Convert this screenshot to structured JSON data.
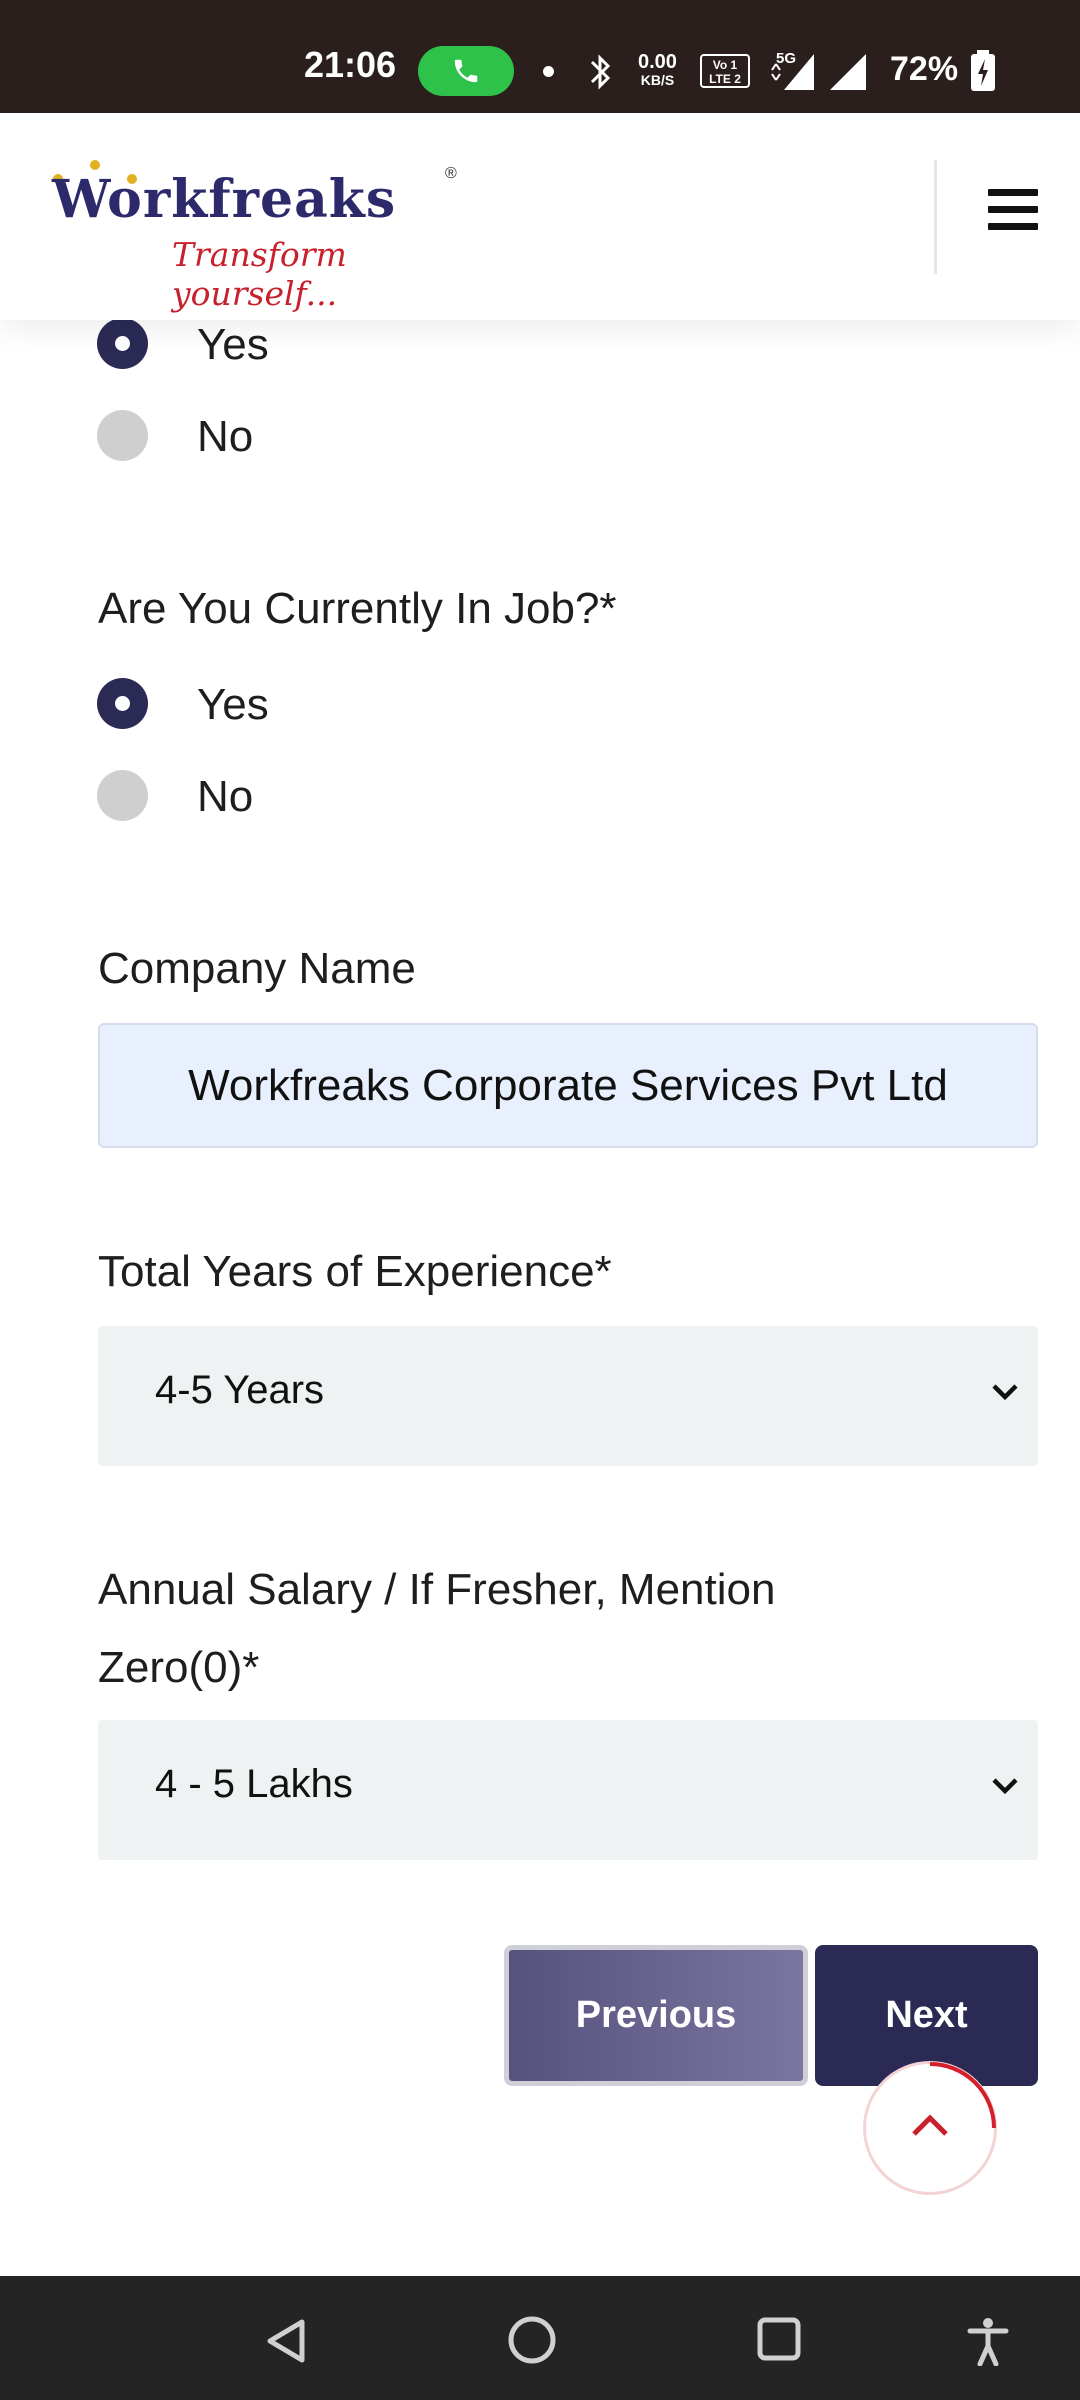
{
  "status_bar": {
    "time": "21:06",
    "net_speed_value": "0.00",
    "net_speed_unit": "KB/S",
    "network_type": "5G",
    "volte": "VoLTE 2",
    "battery": "72%"
  },
  "header": {
    "logo_text": "Workfreaks",
    "logo_reg": "®",
    "logo_tagline": "Transform yourself..."
  },
  "form": {
    "prev_question": {
      "options": [
        "Yes",
        "No"
      ],
      "selected": "Yes"
    },
    "job_question": {
      "label": "Are You Currently In Job?*",
      "options": [
        "Yes",
        "No"
      ],
      "selected": "Yes"
    },
    "company": {
      "label": "Company Name",
      "value": "Workfreaks Corporate Services Pvt Ltd"
    },
    "experience": {
      "label": "Total Years of Experience*",
      "value": "4-5 Years"
    },
    "salary": {
      "label_line1": "Annual Salary / If Fresher, Mention",
      "label_line2": "Zero(0)*",
      "value": "4 - 5 Lakhs"
    },
    "previous_label": "Previous",
    "next_label": "Next"
  },
  "colors": {
    "primary": "#2b2a55",
    "accent": "#c8202d",
    "input_bg": "#e9f0fd",
    "select_bg": "#eff2f3"
  },
  "icons": {
    "menu": "hamburger-icon",
    "scroll_top": "chevron-up-icon",
    "nav": [
      "back-icon",
      "home-icon",
      "recents-icon",
      "accessibility-icon"
    ]
  }
}
